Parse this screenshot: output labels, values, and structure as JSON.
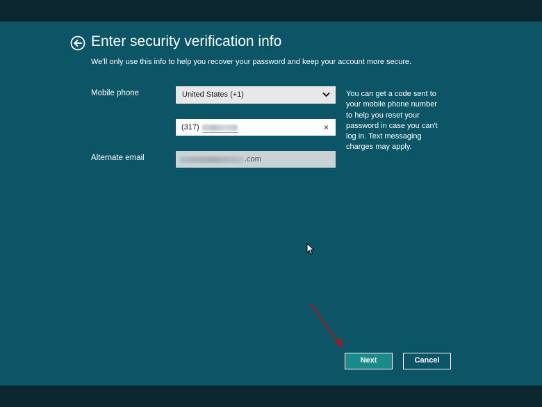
{
  "page": {
    "title": "Enter security verification info",
    "subtitle": "We'll only use this info to help you recover your password and keep your account more secure."
  },
  "form": {
    "mobile_phone_label": "Mobile phone",
    "country_select_value": "United States (+1)",
    "phone_prefix": "(317)",
    "phone_redacted": "",
    "alternate_email_label": "Alternate email",
    "email_redacted": "",
    "email_suffix": ".com",
    "clear_glyph": "×"
  },
  "help_text": "You can get a code sent to your mobile phone number to help you reset your password in case you can't log in. Text messaging charges may apply.",
  "buttons": {
    "next": "Next",
    "cancel": "Cancel"
  },
  "icons": {
    "back": "back-arrow-icon",
    "dropdown": "chevron-down-icon",
    "clear": "clear-icon",
    "pointer": "mouse-pointer-icon",
    "annotation": "red-annotation-arrow"
  },
  "colors": {
    "background": "#0b5566",
    "band": "#0c2730",
    "next_button": "#1a8a8a",
    "annotation_arrow": "#a01820"
  }
}
